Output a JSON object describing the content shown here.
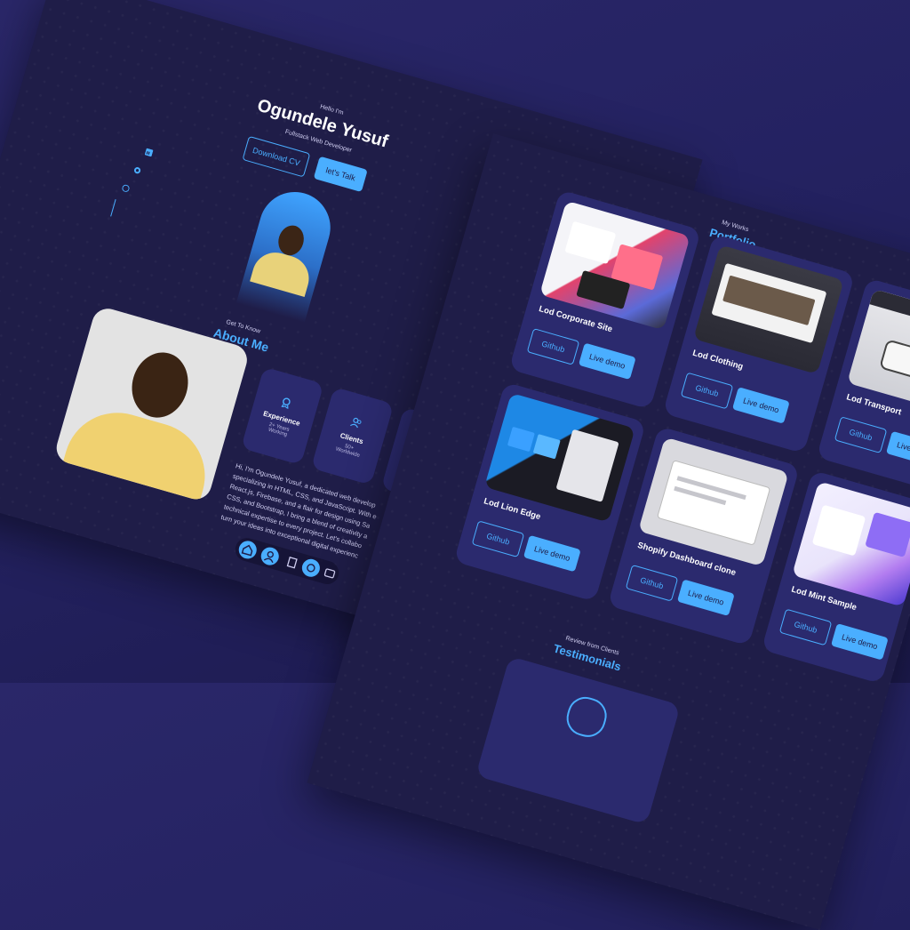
{
  "hero": {
    "greeting": "Hello I'm",
    "name": "Ogundele Yusuf",
    "role": "Fullstack Web Developer",
    "download_cv": "Download CV",
    "lets_talk": "let's Talk"
  },
  "about": {
    "subtitle": "Get To Know",
    "title": "About Me",
    "cards": [
      {
        "title": "Experience",
        "line1": "2+ Years",
        "line2": "Working",
        "icon": "award-icon"
      },
      {
        "title": "Clients",
        "line1": "50+",
        "line2": "Worldwide",
        "icon": "users-icon"
      }
    ],
    "bio": [
      "Hi, I'm Ogundele Yusuf, a dedicated web develop",
      "specializing in HTML, CSS, and JavaScript. With e",
      "React.js, Firebase, and a flair for design using Sa",
      "CSS, and Bootstrap, I bring a blend of creativity a",
      "technical expertise to every project. Let's collabo",
      "turn your ideas into exceptional digital experienc"
    ]
  },
  "portfolio": {
    "subtitle": "My Works",
    "title": "Portfolio",
    "projects": [
      {
        "name": "Lod Corporate Site",
        "github": "Github",
        "demo": "Live demo"
      },
      {
        "name": "Lod Clothing",
        "github": "Github",
        "demo": "Live demo"
      },
      {
        "name": "Lod Transport",
        "github": "Github",
        "demo": "Live demo"
      },
      {
        "name": "Lod Lion Edge",
        "github": "Github",
        "demo": "Live demo"
      },
      {
        "name": "Shopify Dashboard clone",
        "github": "Github",
        "demo": "Live demo"
      },
      {
        "name": "Lod Mint Sample",
        "github": "Github",
        "demo": "Live demo"
      }
    ]
  },
  "testimonials": {
    "subtitle": "Review from Clients",
    "title": "Testimonials"
  },
  "colors": {
    "accent": "#4aaeff",
    "card": "#2b2a6e",
    "panel": "#1f1d48",
    "background": "#262366"
  }
}
